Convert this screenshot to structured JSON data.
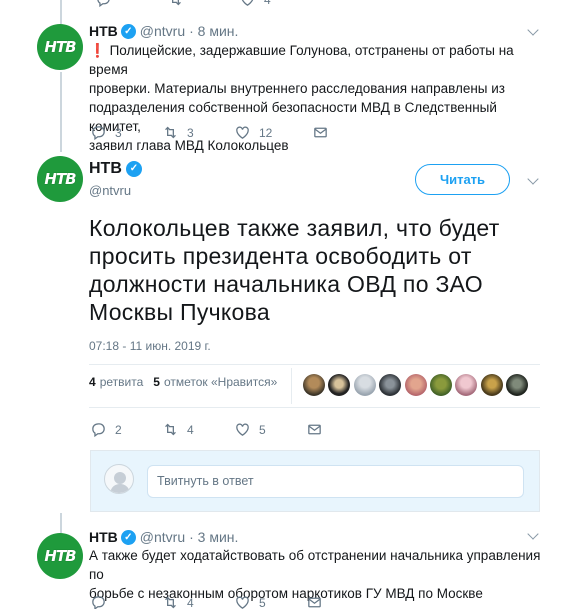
{
  "tweet1": {
    "name": "НТВ",
    "handle": "@ntvru",
    "time": "· 8 мин.",
    "exclamation": "❗",
    "line1": "Полицейские, задержавшие Голунова, отстранены от работы на время",
    "line2": "проверки. Материалы внутреннего расследования направлены из",
    "line3": "подразделения собственной безопасности МВД в Следственный комитет,",
    "line4": "заявил глава МВД Колокольцев",
    "replies": "3",
    "retweets": "3",
    "likes": "12"
  },
  "main": {
    "name": "НТВ",
    "handle": "@ntvru",
    "follow_label": "Читать",
    "text_line1": "Колокольцев также заявил, что будет",
    "text_line2": "просить президента освободить от",
    "text_line3": "должности начальника ОВД по ЗАО",
    "text_line4": "Москвы Пучкова",
    "timestamp": "07:18 - 11 июн. 2019 г.",
    "retweet_count": "4",
    "retweet_label": "ретвита",
    "like_count": "5",
    "like_label": "отметок «Нравится»",
    "replies": "2",
    "retweets": "4",
    "likes": "5"
  },
  "reply": {
    "placeholder": "Твитнуть в ответ"
  },
  "tweet3": {
    "name": "НТВ",
    "handle": "@ntvru",
    "time": "· 3 мин.",
    "line1": "А также будет ходатайствовать об отстранении начальника управления по",
    "line2": "борьбе с незаконным оборотом наркотиков ГУ МВД по Москве",
    "retweets": "4",
    "likes": "5"
  },
  "top_partial": {
    "count": "4"
  },
  "colors": {
    "accent": "#1da1f2",
    "ntv_green": "#1f9a3c",
    "muted": "#657786"
  },
  "avatar_logo": "НТВ",
  "icons": [
    "reply-icon",
    "retweet-icon",
    "like-icon",
    "dm-icon",
    "verified-icon",
    "caret-icon"
  ]
}
